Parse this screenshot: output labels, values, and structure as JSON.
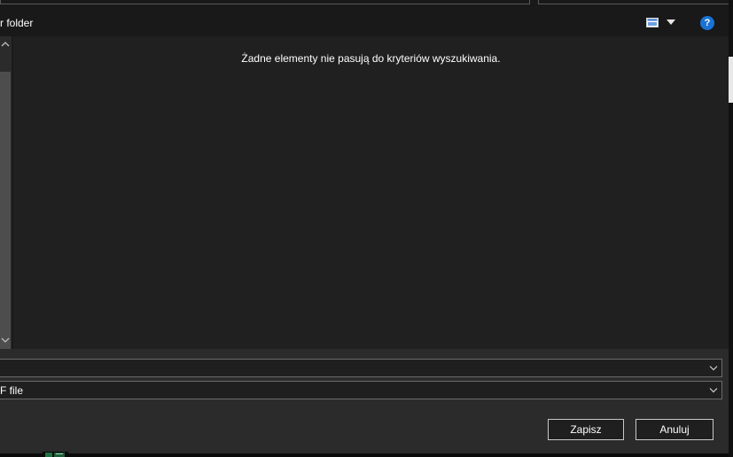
{
  "toolbar": {
    "new_folder_label": "r folder",
    "view_icon": "view-options-icon",
    "help_label": "?"
  },
  "file_list": {
    "empty_message": "Żadne elementy nie pasują do kryteriów wyszukiwania."
  },
  "form": {
    "filename_value": "",
    "filetype_value": "F file"
  },
  "buttons": {
    "save_label": "Zapisz",
    "cancel_label": "Anuluj"
  },
  "colors": {
    "help_blue": "#1a73d4",
    "list_background": "#202020",
    "panel_background": "#2b2b2b",
    "excel_green": "#217346"
  }
}
